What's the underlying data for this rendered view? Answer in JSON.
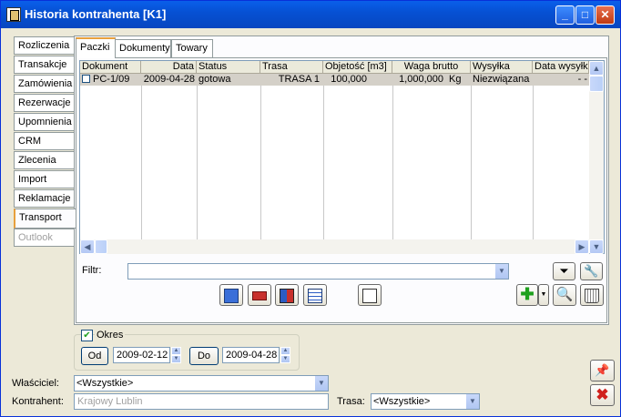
{
  "window": {
    "title": "Historia kontrahenta [K1]"
  },
  "side_tabs": [
    "Rozliczenia",
    "Transakcje",
    "Zamówienia",
    "Rezerwacje",
    "Upomnienia",
    "CRM",
    "Zlecenia",
    "Import",
    "Reklamacje",
    "Transport",
    "Outlook"
  ],
  "top_tabs": [
    "Paczki",
    "Dokumenty",
    "Towary"
  ],
  "grid": {
    "columns": [
      "Dokument",
      "Data",
      "Status",
      "Trasa",
      "Objetość [m3]",
      "Waga brutto",
      "Wysyłka",
      "Data wysyłki"
    ],
    "rows": [
      {
        "dokument": "PC-1/09",
        "data": "2009-04-28",
        "status": "gotowa",
        "trasa": "TRASA 1",
        "objetosc": "100,000",
        "waga": "1,000,000",
        "jm": "Kg",
        "wysylka": "Niezwiązana",
        "data_wysylki": "- -"
      }
    ]
  },
  "filter": {
    "label": "Filtr:",
    "value": ""
  },
  "period": {
    "checkbox_label": "Okres",
    "checked": true,
    "from_label": "Od",
    "from_value": "2009-02-12",
    "to_label": "Do",
    "to_value": "2009-04-28"
  },
  "owner": {
    "label": "Właściciel:",
    "value": "<Wszystkie>"
  },
  "contractor": {
    "label": "Kontrahent:",
    "value": "Krajowy Lublin"
  },
  "route": {
    "label": "Trasa:",
    "value": "<Wszystkie>"
  },
  "colors": {
    "titlebar": "#0651D4",
    "tab_accent": "#E8A03C",
    "selected_row": "#D4D0C8"
  }
}
